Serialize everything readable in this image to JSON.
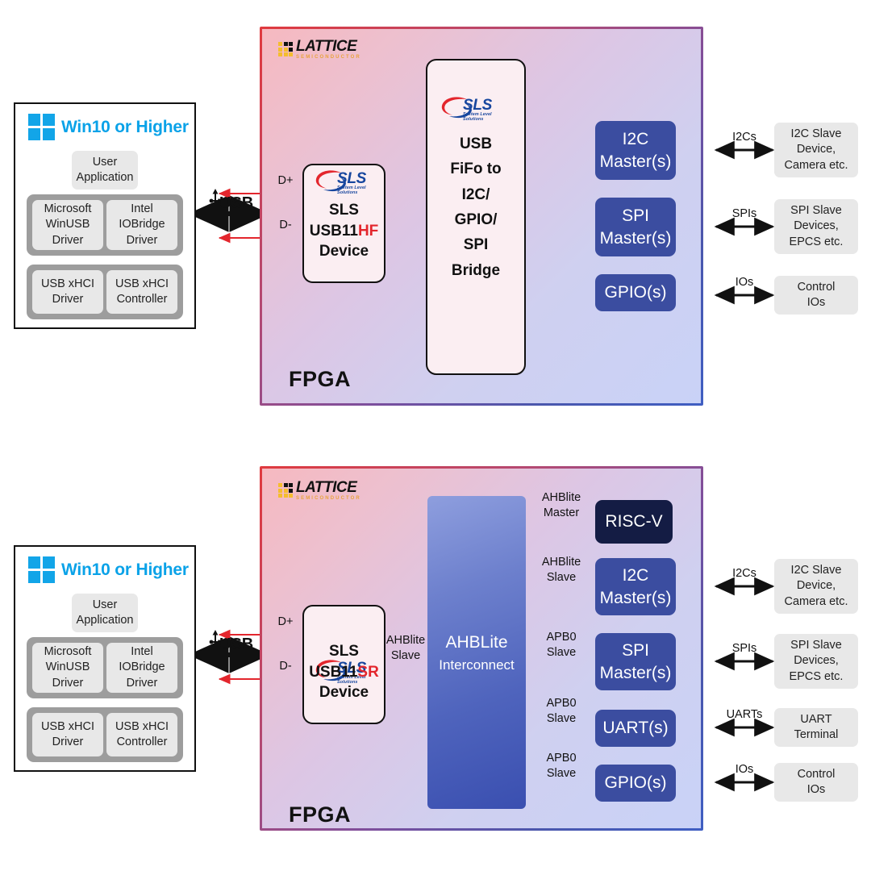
{
  "brand": {
    "lattice_name": "LATTICE",
    "lattice_sub": "SEMICONDUCTOR",
    "sls_word": "SLS",
    "sls_sub": "System Level Solutions"
  },
  "diagram1": {
    "fpga_label": "FPGA",
    "host": {
      "title": "Win10 or Higher",
      "user_app": "User\nApplication",
      "drivers": [
        "Microsoft\nWinUSB\nDriver",
        "Intel\nIOBridge\nDriver"
      ],
      "xhci": [
        "USB xHCI\nDriver",
        "USB xHCI\nController"
      ]
    },
    "usb_label": "USB",
    "dplus": "D+",
    "dminus": "D-",
    "device": {
      "line1": "SLS",
      "line2_a": "USB11",
      "line2_b": "HF",
      "line3": "Device"
    },
    "bridge": "USB\nFiFo to\nI2C/\nGPIO/\nSPI\nBridge",
    "peripherals": [
      {
        "name": "I2C\nMaster(s)",
        "bus": "I2Cs",
        "external": "I2C Slave\nDevice,\nCamera etc."
      },
      {
        "name": "SPI\nMaster(s)",
        "bus": "SPIs",
        "external": "SPI Slave\nDevices,\nEPCS etc."
      },
      {
        "name": "GPIO(s)",
        "bus": "IOs",
        "external": "Control\nIOs"
      }
    ]
  },
  "diagram2": {
    "fpga_label": "FPGA",
    "host": {
      "title": "Win10 or Higher",
      "user_app": "User\nApplication",
      "drivers": [
        "Microsoft\nWinUSB\nDriver",
        "Intel\nIOBridge\nDriver"
      ],
      "xhci": [
        "USB xHCI\nDriver",
        "USB xHCI\nController"
      ]
    },
    "usb_label": "USB",
    "dplus": "D+",
    "dminus": "D-",
    "device": {
      "line1": "SLS",
      "line2_a": "USB11",
      "line2_b": "SR",
      "line3": "Device"
    },
    "device_bus": "AHBlite\nSlave",
    "interconnect": "AHBLite\nInterconnect",
    "peripherals": [
      {
        "name": "RISC-V",
        "bus": "AHBlite\nMaster",
        "external": null,
        "extbus": null
      },
      {
        "name": "I2C\nMaster(s)",
        "bus": "AHBlite\nSlave",
        "external": "I2C Slave\nDevice,\nCamera etc.",
        "extbus": "I2Cs"
      },
      {
        "name": "SPI\nMaster(s)",
        "bus": "APB0\nSlave",
        "external": "SPI Slave\nDevices,\nEPCS etc.",
        "extbus": "SPIs"
      },
      {
        "name": "UART(s)",
        "bus": "APB0\nSlave",
        "external": "UART\nTerminal",
        "extbus": "UARTs"
      },
      {
        "name": "GPIO(s)",
        "bus": "APB0\nSlave",
        "external": "Control\nIOs",
        "extbus": "IOs"
      }
    ]
  },
  "colors": {
    "blue_block": "#3b4da0",
    "navy_block": "#141c44",
    "windows_blue": "#0aa2e8",
    "red_accent": "#e3262d",
    "gray_box": "#e8e8e8"
  }
}
